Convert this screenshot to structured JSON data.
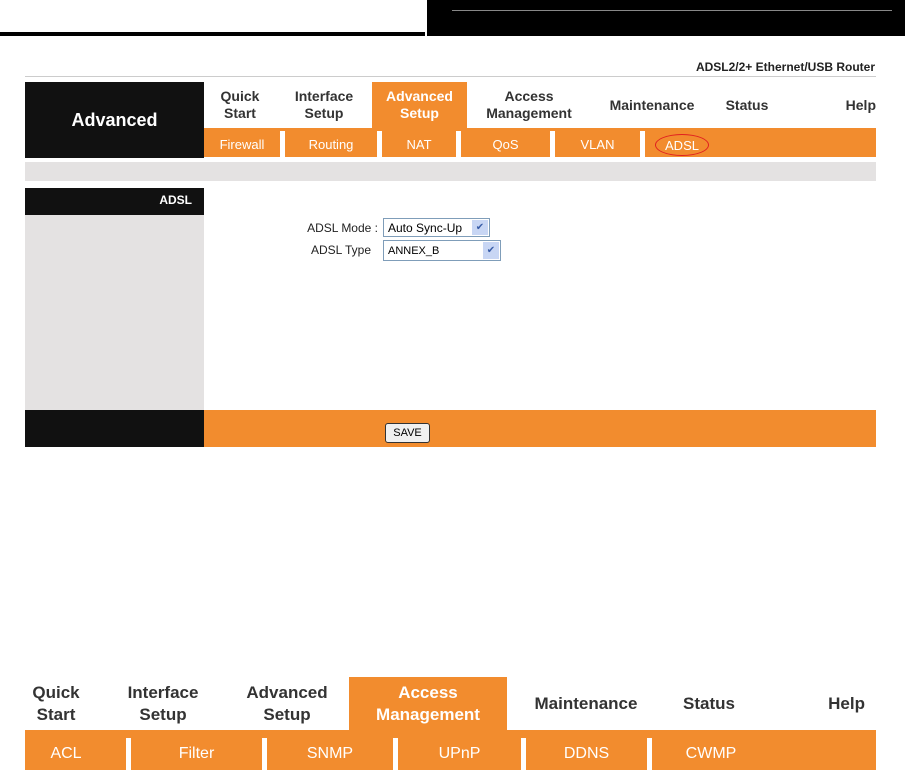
{
  "product_title": "ADSL2/2+ Ethernet/USB Router",
  "section_label": "Advanced",
  "nav": [
    {
      "label": "Quick\nStart"
    },
    {
      "label": "Interface\nSetup"
    },
    {
      "label": "Advanced\nSetup"
    },
    {
      "label": "Access\nManagement"
    },
    {
      "label": "Maintenance"
    },
    {
      "label": "Status"
    },
    {
      "label": "Help"
    }
  ],
  "subnav": [
    "Firewall",
    "Routing",
    "NAT",
    "QoS",
    "VLAN",
    "ADSL"
  ],
  "sidebar_label": "ADSL",
  "form": {
    "mode_label": "ADSL Mode :",
    "mode_value": "Auto Sync-Up",
    "type_label": "ADSL Type",
    "type_value": "ANNEX_B"
  },
  "save_label": "SAVE",
  "nav2_subnav": [
    "ACL",
    "Filter",
    "SNMP",
    "UPnP",
    "DDNS",
    "CWMP"
  ],
  "colors": {
    "accent": "#f28c2e",
    "dark": "#111111",
    "annotation": "#e02020"
  }
}
